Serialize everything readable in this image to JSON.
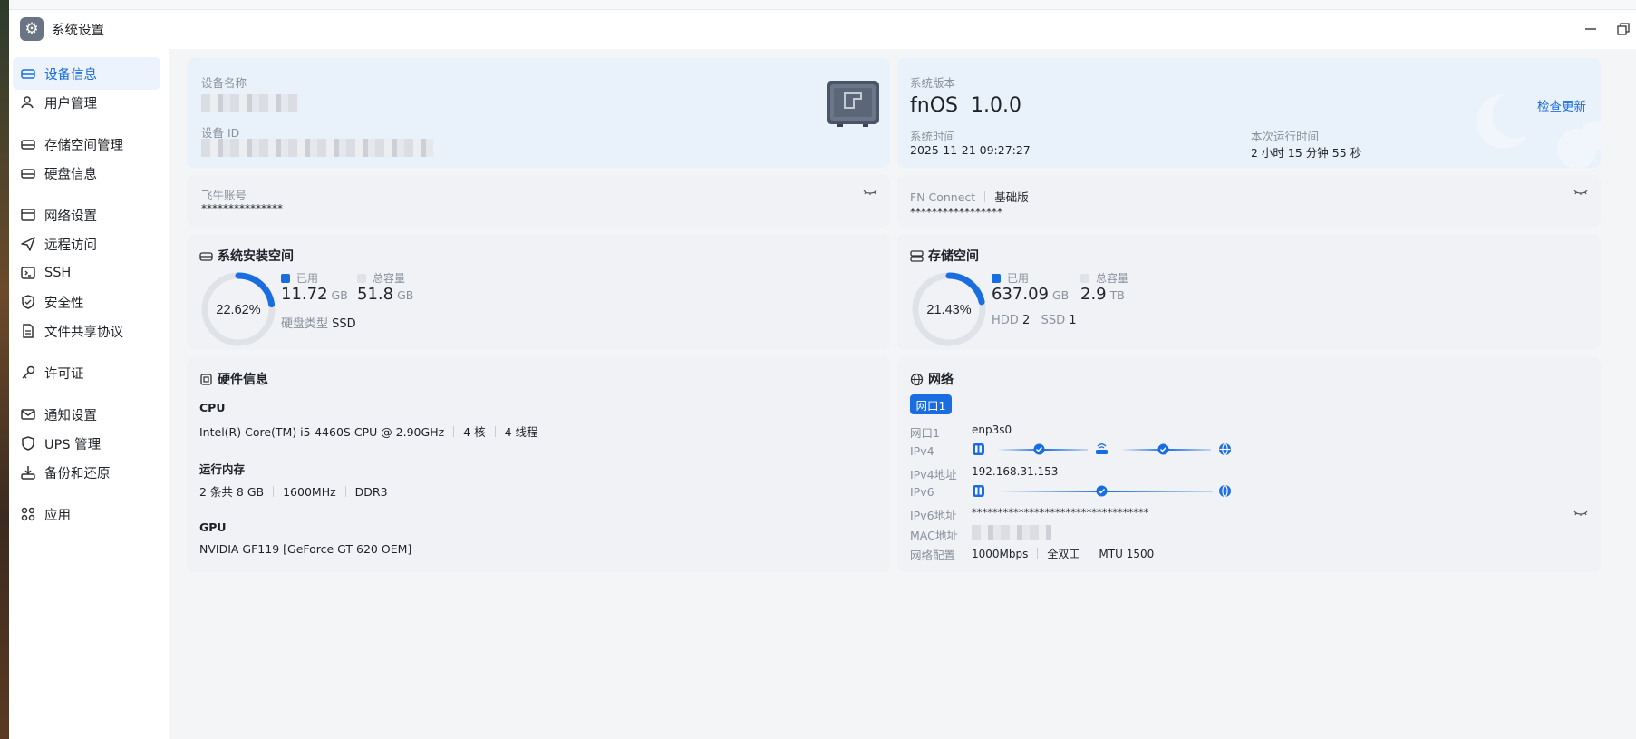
{
  "app": {
    "title": "系统设置",
    "icon": "gear-icon"
  },
  "sidebar": {
    "items": [
      {
        "label": "设备信息",
        "icon": "device-icon",
        "active": true
      },
      {
        "label": "用户管理",
        "icon": "user-icon"
      },
      {
        "label": "存储空间管理",
        "icon": "storage-icon"
      },
      {
        "label": "硬盘信息",
        "icon": "disk-icon"
      },
      {
        "label": "网络设置",
        "icon": "network-icon"
      },
      {
        "label": "远程访问",
        "icon": "send-icon"
      },
      {
        "label": "SSH",
        "icon": "ssh-icon"
      },
      {
        "label": "安全性",
        "icon": "shield-icon"
      },
      {
        "label": "文件共享协议",
        "icon": "file-icon"
      },
      {
        "label": "许可证",
        "icon": "key-icon"
      },
      {
        "label": "通知设置",
        "icon": "mail-icon"
      },
      {
        "label": "UPS 管理",
        "icon": "ups-icon"
      },
      {
        "label": "备份和还原",
        "icon": "backup-icon"
      },
      {
        "label": "应用",
        "icon": "apps-icon"
      }
    ]
  },
  "device": {
    "name_label": "设备名称",
    "id_label": "设备 ID"
  },
  "system": {
    "version_label": "系统版本",
    "os_name": "fnOS",
    "version": "1.0.0",
    "check_update": "检查更新",
    "time_label": "系统时间",
    "time_value": "2025-11-21 09:27:27",
    "uptime_label": "本次运行时间",
    "uptime_value": "2 小时 15 分钟 55 秒"
  },
  "account": {
    "label": "飞牛账号",
    "value": "***************"
  },
  "fnconnect": {
    "label": "FN Connect",
    "tier": "基础版",
    "value": "*****************"
  },
  "sys_space": {
    "title": "系统安装空间",
    "percent_label": "22.62%",
    "percent": 22.62,
    "used_label": "已用",
    "used_value": "11.72",
    "used_unit": "GB",
    "total_label": "总容量",
    "total_value": "51.8",
    "total_unit": "GB",
    "disk_type_label": "硬盘类型",
    "disk_type_value": "SSD"
  },
  "storage": {
    "title": "存储空间",
    "percent_label": "21.43%",
    "percent": 21.43,
    "used_label": "已用",
    "used_value": "637.09",
    "used_unit": "GB",
    "total_label": "总容量",
    "total_value": "2.9",
    "total_unit": "TB",
    "hdd_label": "HDD",
    "hdd_value": "2",
    "ssd_label": "SSD",
    "ssd_value": "1"
  },
  "hardware": {
    "title": "硬件信息",
    "cpu_label": "CPU",
    "cpu_model": "Intel(R) Core(TM) i5-4460S CPU @ 2.90GHz",
    "cpu_cores": "4 核",
    "cpu_threads": "4 线程",
    "mem_label": "运行内存",
    "mem_size": "2 条共 8 GB",
    "mem_freq": "1600MHz",
    "mem_type": "DDR3",
    "gpu_label": "GPU",
    "gpu_model": "NVIDIA GF119 [GeForce GT 620 OEM]"
  },
  "network": {
    "title": "网络",
    "tab": "网口1",
    "port_label": "网口1",
    "port_value": "enp3s0",
    "ipv4_label": "IPv4",
    "ipv4_addr_label": "IPv4地址",
    "ipv4_addr_value": "192.168.31.153",
    "ipv6_label": "IPv6",
    "ipv6_addr_label": "IPv6地址",
    "ipv6_addr_value": "**********************************",
    "mac_label": "MAC地址",
    "config_label": "网络配置",
    "speed": "1000Mbps",
    "duplex": "全双工",
    "mtu": "MTU 1500"
  },
  "colors": {
    "accent": "#1a6de0",
    "track": "#dfe2e7"
  }
}
